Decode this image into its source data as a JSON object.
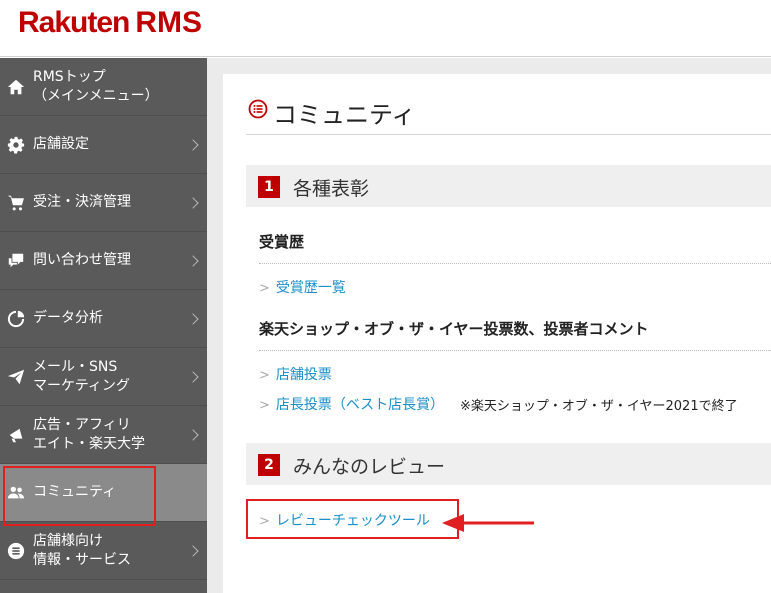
{
  "header": {
    "logo_main": "Rakuten",
    "logo_sub": "RMS"
  },
  "sidebar": {
    "items": [
      {
        "label": "RMSトップ\n（メインメニュー）",
        "icon": "home-icon",
        "chevron": false
      },
      {
        "label": "店舗設定",
        "icon": "gear-icon",
        "chevron": true
      },
      {
        "label": "受注・決済管理",
        "icon": "cart-icon",
        "chevron": true
      },
      {
        "label": "問い合わせ管理",
        "icon": "chat-icon",
        "chevron": true
      },
      {
        "label": "データ分析",
        "icon": "pie-chart-icon",
        "chevron": true
      },
      {
        "label": "メール・SNS\nマーケティング",
        "icon": "paper-plane-icon",
        "chevron": true
      },
      {
        "label": "広告・アフィリ\nエイト・楽天大学",
        "icon": "megaphone-icon",
        "chevron": true
      },
      {
        "label": "コミュニティ",
        "icon": "users-icon",
        "chevron": false,
        "active": true
      },
      {
        "label": "店舗様向け\n情報・サービス",
        "icon": "list-icon",
        "chevron": true
      }
    ]
  },
  "main": {
    "page_title": "コミュニティ",
    "sections": [
      {
        "number": "1",
        "title": "各種表彰",
        "groups": [
          {
            "heading": "受賞歴",
            "links": [
              "受賞歴一覧"
            ]
          },
          {
            "heading": "楽天ショップ・オブ・ザ・イヤー投票数、投票者コメント",
            "links": [
              "店舗投票",
              "店長投票（ベスト店長賞）"
            ]
          }
        ],
        "note": "※楽天ショップ・オブ・ザ・イヤー2021で終了"
      },
      {
        "number": "2",
        "title": "みんなのレビュー",
        "links": [
          "レビューチェックツール"
        ]
      }
    ],
    "link_chevron": ">"
  },
  "colors": {
    "brand": "#bf0000",
    "link": "#1a8fc9",
    "sidebar": "#5a5a5a",
    "highlight": "#e02020"
  }
}
